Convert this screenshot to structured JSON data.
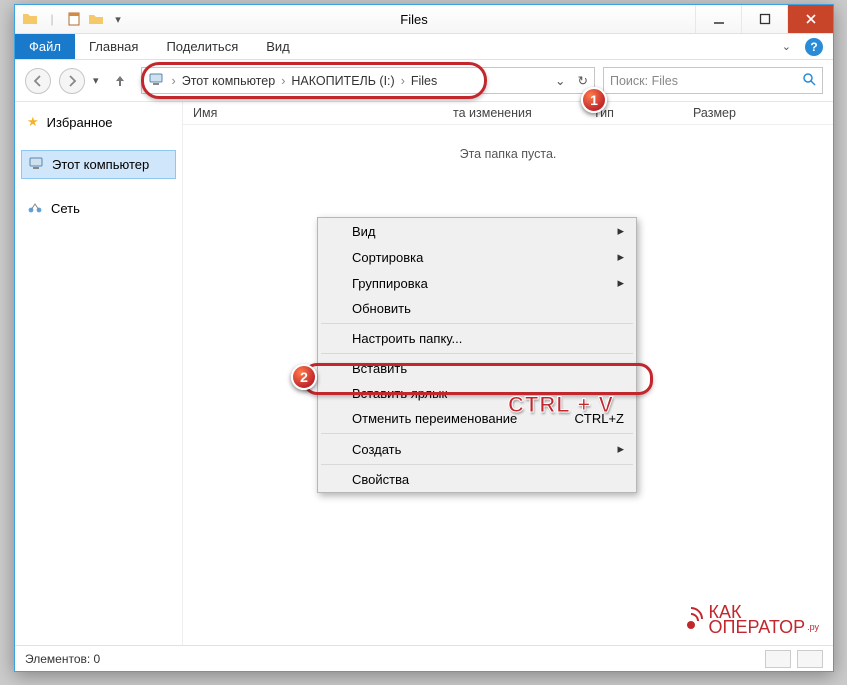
{
  "window": {
    "title": "Files"
  },
  "menu": {
    "file": "Файл",
    "tabs": [
      "Главная",
      "Поделиться",
      "Вид"
    ]
  },
  "breadcrumb": {
    "items": [
      "Этот компьютер",
      "НАКОПИТЕЛЬ (I:)",
      "Files"
    ]
  },
  "search": {
    "placeholder": "Поиск: Files"
  },
  "columns": {
    "name": "Имя",
    "date": "та изменения",
    "type": "Тип",
    "size": "Размер"
  },
  "empty_message": "Эта папка пуста.",
  "sidebar": {
    "favorites": "Избранное",
    "this_pc": "Этот компьютер",
    "network": "Сеть"
  },
  "context_menu": {
    "items": [
      {
        "label": "Вид",
        "submenu": true
      },
      {
        "label": "Сортировка",
        "submenu": true
      },
      {
        "label": "Группировка",
        "submenu": true
      },
      {
        "label": "Обновить",
        "submenu": false
      },
      {
        "sep": true
      },
      {
        "label": "Настроить папку...",
        "submenu": false
      },
      {
        "sep": true
      },
      {
        "label": "Вставить",
        "submenu": false
      },
      {
        "label": "Вставить ярлык",
        "submenu": false
      },
      {
        "label": "Отменить переименование",
        "shortcut": "CTRL+Z",
        "submenu": false
      },
      {
        "sep": true
      },
      {
        "label": "Создать",
        "submenu": true
      },
      {
        "sep": true
      },
      {
        "label": "Свойства",
        "submenu": false
      }
    ]
  },
  "statusbar": {
    "text": "Элементов: 0"
  },
  "annotations": {
    "badge1": "1",
    "badge2": "2",
    "shortcut_overlay": "CTRL + V"
  },
  "watermark": {
    "line1": "КАК",
    "line2": "ОПЕРАТОР",
    "suffix": ".ру"
  },
  "colors": {
    "accent": "#1979ca",
    "highlight_red": "#c1272d",
    "close_red": "#c9452a"
  }
}
